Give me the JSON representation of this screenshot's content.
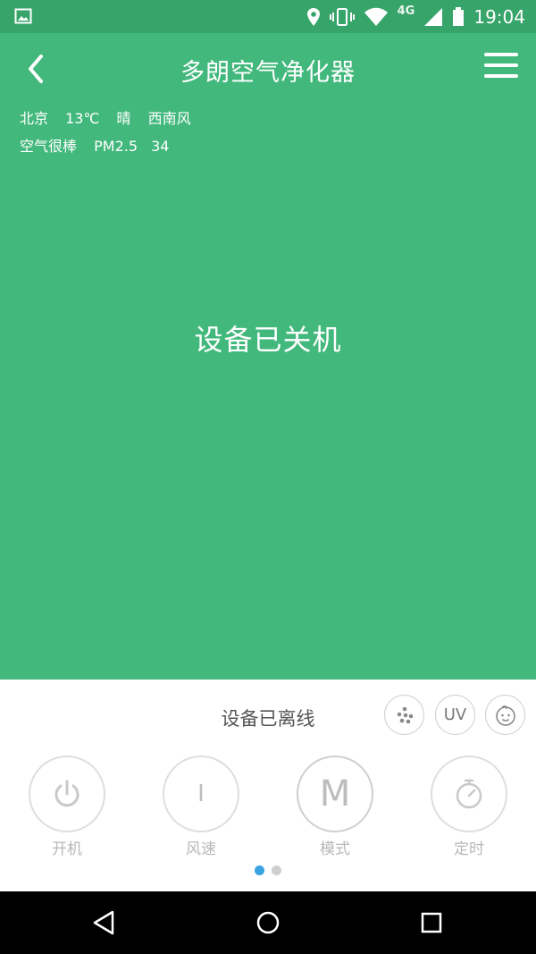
{
  "status_bar": {
    "time": "19:04",
    "network": "4G"
  },
  "header": {
    "title": "多朗空气净化器"
  },
  "weather": {
    "city": "北京",
    "temperature": "13℃",
    "condition": "晴",
    "wind": "西南风",
    "air_quality": "空气很棒",
    "pm_label": "PM2.5",
    "pm_value": "34"
  },
  "device": {
    "status_text": "设备已关机"
  },
  "panel": {
    "offline_text": "设备已离线",
    "uv_label": "UV",
    "controls": [
      {
        "label": "开机",
        "icon": "power-icon"
      },
      {
        "label": "风速",
        "icon": "fan-speed-icon",
        "glyph": "I"
      },
      {
        "label": "模式",
        "icon": "mode-icon",
        "glyph": "M"
      },
      {
        "label": "定时",
        "icon": "timer-icon"
      }
    ],
    "page_indicator": {
      "total": 2,
      "active": 1
    }
  },
  "colors": {
    "primary_green": "#42b87c",
    "status_bar_green": "#37a46a",
    "indicator_blue": "#3aa3e0"
  }
}
